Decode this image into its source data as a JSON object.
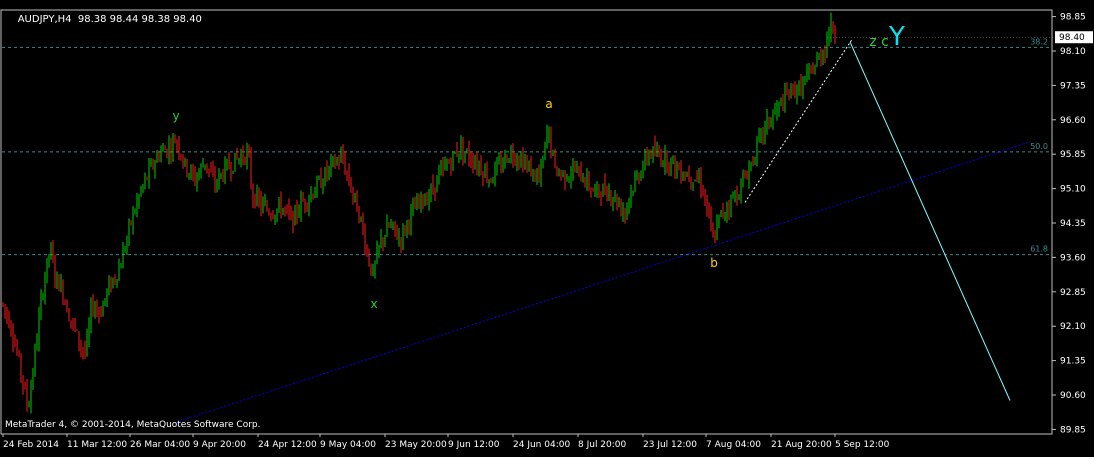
{
  "header": {
    "symbol": "AUDJPY,H4",
    "ohlc": "98.38 98.44 98.38 98.40"
  },
  "copyright": "MetaTrader 4, © 2001-2014, MetaQuotes Software Corp.",
  "colors": {
    "background": "#000000",
    "frame": "#c0c0c0",
    "up_candle": "#00d000",
    "down_candle": "#ff1a1a",
    "fib_line": "#3b8c8c",
    "trend_line": "#0000e0",
    "projection_line": "#7fffff",
    "wave_yellow": "#ffd700",
    "wave_green": "#32cd32",
    "wave_cyan": "#00e5ee"
  },
  "chart_data": {
    "type": "candlestick",
    "symbol": "AUDJPY",
    "timeframe": "H4",
    "ylim": [
      89.75,
      98.95
    ],
    "y_ticks": [
      "98.85",
      "98.10",
      "97.35",
      "96.60",
      "95.85",
      "95.10",
      "94.35",
      "93.60",
      "92.85",
      "92.10",
      "91.35",
      "90.60",
      "89.85"
    ],
    "x_ticks": [
      "24 Feb 2014",
      "11 Mar 12:00",
      "26 Mar 04:00",
      "9 Apr 20:00",
      "24 Apr 12:00",
      "9 May 04:00",
      "23 May 20:00",
      "9 Jun 12:00",
      "24 Jun 04:00",
      "8 Jul 20:00",
      "23 Jul 12:00",
      "7 Aug 04:00",
      "21 Aug 20:00",
      "5 Sep 12:00"
    ],
    "current_price": "98.40",
    "price_path": [
      [
        0,
        92.7
      ],
      [
        10,
        92.2
      ],
      [
        20,
        91.2
      ],
      [
        28,
        90.3
      ],
      [
        35,
        91.5
      ],
      [
        42,
        92.8
      ],
      [
        50,
        93.8
      ],
      [
        55,
        93.2
      ],
      [
        62,
        92.9
      ],
      [
        70,
        92.3
      ],
      [
        80,
        91.7
      ],
      [
        86,
        91.5
      ],
      [
        92,
        92.6
      ],
      [
        100,
        92.4
      ],
      [
        110,
        93.0
      ],
      [
        120,
        93.4
      ],
      [
        130,
        94.3
      ],
      [
        140,
        95.0
      ],
      [
        150,
        95.5
      ],
      [
        160,
        95.9
      ],
      [
        170,
        96.0
      ],
      [
        176,
        96.2
      ],
      [
        185,
        95.6
      ],
      [
        195,
        95.3
      ],
      [
        205,
        95.7
      ],
      [
        215,
        95.2
      ],
      [
        225,
        95.5
      ],
      [
        235,
        95.7
      ],
      [
        248,
        95.9
      ],
      [
        252,
        95.0
      ],
      [
        262,
        94.7
      ],
      [
        272,
        94.6
      ],
      [
        282,
        94.7
      ],
      [
        292,
        94.4
      ],
      [
        302,
        94.8
      ],
      [
        312,
        95.0
      ],
      [
        322,
        95.3
      ],
      [
        332,
        95.6
      ],
      [
        342,
        95.8
      ],
      [
        350,
        95.2
      ],
      [
        360,
        94.5
      ],
      [
        366,
        93.8
      ],
      [
        373,
        93.2
      ],
      [
        380,
        93.9
      ],
      [
        390,
        94.3
      ],
      [
        400,
        94.0
      ],
      [
        410,
        94.5
      ],
      [
        420,
        94.8
      ],
      [
        430,
        95.0
      ],
      [
        440,
        95.4
      ],
      [
        450,
        95.7
      ],
      [
        460,
        96.0
      ],
      [
        470,
        95.8
      ],
      [
        480,
        95.6
      ],
      [
        490,
        95.3
      ],
      [
        500,
        95.6
      ],
      [
        510,
        95.9
      ],
      [
        520,
        95.8
      ],
      [
        530,
        95.5
      ],
      [
        540,
        95.3
      ],
      [
        548,
        96.4
      ],
      [
        555,
        95.5
      ],
      [
        565,
        95.4
      ],
      [
        575,
        95.5
      ],
      [
        585,
        95.3
      ],
      [
        595,
        95.0
      ],
      [
        605,
        95.1
      ],
      [
        615,
        94.9
      ],
      [
        625,
        94.6
      ],
      [
        630,
        95.0
      ],
      [
        640,
        95.5
      ],
      [
        650,
        95.9
      ],
      [
        660,
        95.8
      ],
      [
        670,
        95.7
      ],
      [
        680,
        95.5
      ],
      [
        690,
        95.4
      ],
      [
        700,
        95.3
      ],
      [
        706,
        94.8
      ],
      [
        713,
        93.95
      ],
      [
        720,
        94.5
      ],
      [
        730,
        94.8
      ],
      [
        740,
        95.1
      ],
      [
        750,
        95.6
      ],
      [
        760,
        96.2
      ],
      [
        770,
        96.6
      ],
      [
        780,
        96.9
      ],
      [
        790,
        97.2
      ],
      [
        800,
        97.3
      ],
      [
        810,
        97.6
      ],
      [
        818,
        97.9
      ],
      [
        825,
        98.2
      ],
      [
        830,
        98.6
      ],
      [
        836,
        98.5
      ]
    ],
    "fib_levels": [
      {
        "label": "38.2",
        "price": 98.18
      },
      {
        "label": "50.0",
        "price": 95.9
      },
      {
        "label": "61.8",
        "price": 93.66
      }
    ],
    "wave_labels": [
      {
        "text": "y",
        "color": "wave_green"
      },
      {
        "text": "x",
        "color": "wave_green"
      },
      {
        "text": "a",
        "color": "wave_yellow"
      },
      {
        "text": "b",
        "color": "wave_yellow"
      },
      {
        "text": "z",
        "color": "wave_green"
      },
      {
        "text": "c",
        "color": "wave_green"
      },
      {
        "text": "Y",
        "color": "wave_cyan"
      }
    ],
    "lines": [
      {
        "name": "support-trendline",
        "from": [
          "26 Mar 04:00",
          90.0
        ],
        "to": [
          "right edge",
          96.1
        ],
        "color": "trend_line"
      },
      {
        "name": "channel-dotted",
        "from": [
          "14 Aug",
          94.8
        ],
        "to": [
          "5 Sep 12:00",
          98.35
        ],
        "color": "white"
      },
      {
        "name": "projection-line",
        "from": [
          "5 Sep 12:00",
          98.3
        ],
        "to": [
          "future",
          90.5
        ],
        "color": "projection_line"
      }
    ],
    "grid": false
  }
}
